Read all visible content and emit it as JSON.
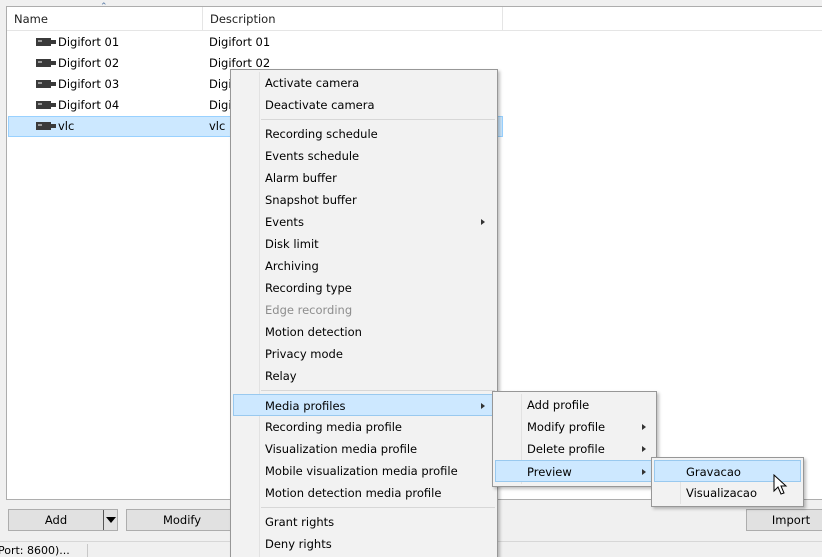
{
  "list": {
    "columns": [
      {
        "label": "Name"
      },
      {
        "label": "Description"
      }
    ],
    "rows": [
      {
        "name": "Digifort 01",
        "description": "Digifort 01"
      },
      {
        "name": "Digifort 02",
        "description": "Digifort 02"
      },
      {
        "name": "Digifort 03",
        "description": "Digi"
      },
      {
        "name": "Digifort 04",
        "description": "Digi"
      },
      {
        "name": "vlc",
        "description": "vlc"
      }
    ],
    "selected_row": 4,
    "row_icon": "camera-icon"
  },
  "toolbar": {
    "add_label": "Add",
    "modify_label": "Modify",
    "import_label": "Import"
  },
  "status": {
    "text": "Port: 8600)..."
  },
  "context_menu": {
    "items": [
      {
        "label": "Activate camera"
      },
      {
        "label": "Deactivate camera"
      },
      {
        "label": "Recording schedule"
      },
      {
        "label": "Events schedule"
      },
      {
        "label": "Alarm buffer"
      },
      {
        "label": "Snapshot buffer"
      },
      {
        "label": "Events"
      },
      {
        "label": "Disk limit"
      },
      {
        "label": "Archiving"
      },
      {
        "label": "Recording type"
      },
      {
        "label": "Edge recording"
      },
      {
        "label": "Motion detection"
      },
      {
        "label": "Privacy mode"
      },
      {
        "label": "Relay"
      },
      {
        "label": "Media profiles"
      },
      {
        "label": "Recording media profile"
      },
      {
        "label": "Visualization media profile"
      },
      {
        "label": "Mobile visualization media profile"
      },
      {
        "label": "Motion detection media profile"
      },
      {
        "label": "Grant rights"
      },
      {
        "label": "Deny rights"
      }
    ],
    "disabled_index": 10,
    "highlighted_index": 14
  },
  "media_profiles_menu": {
    "items": [
      {
        "label": "Add profile"
      },
      {
        "label": "Modify profile"
      },
      {
        "label": "Delete profile"
      },
      {
        "label": "Preview"
      }
    ],
    "highlighted_index": 3
  },
  "preview_menu": {
    "items": [
      {
        "label": "Gravacao"
      },
      {
        "label": "Visualizacao"
      }
    ],
    "highlighted_index": 0
  },
  "colors": {
    "selection_bg": "#cce8ff",
    "selection_border": "#99d1ff",
    "menu_bg": "#f2f2f2",
    "menu_highlight": "#cde8ff"
  }
}
